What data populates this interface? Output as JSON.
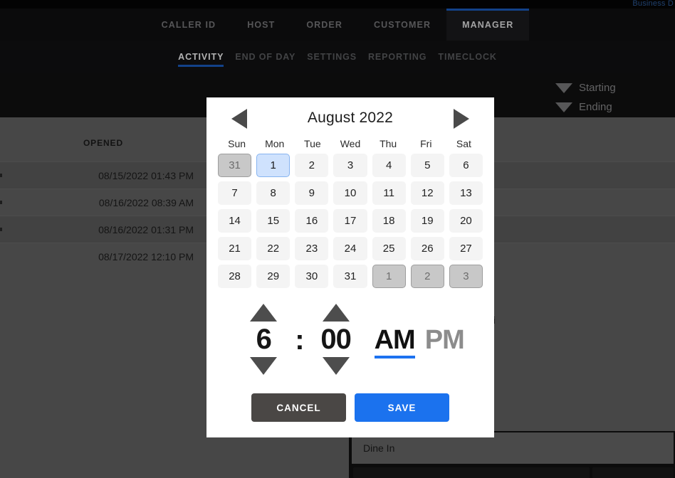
{
  "header": {
    "business_label": "Business D",
    "main_tabs": [
      {
        "label": "CALLER ID",
        "active": false
      },
      {
        "label": "HOST",
        "active": false
      },
      {
        "label": "ORDER",
        "active": false
      },
      {
        "label": "CUSTOMER",
        "active": false
      },
      {
        "label": "MANAGER",
        "active": true
      }
    ],
    "sub_tabs": [
      {
        "label": "ACTIVITY",
        "active": true
      },
      {
        "label": "END OF DAY",
        "active": false
      },
      {
        "label": "SETTINGS",
        "active": false
      },
      {
        "label": "REPORTING",
        "active": false
      },
      {
        "label": "TIMECLOCK",
        "active": false
      }
    ],
    "accent_color": "#1c5fc4"
  },
  "filters": [
    {
      "label": "Starting",
      "icon": "triangle-down-icon"
    },
    {
      "label": "Ending",
      "icon": "triangle-down-icon"
    }
  ],
  "table": {
    "columns": [
      "OPENED"
    ],
    "rows": [
      {
        "opened": "08/15/2022 01:43 PM"
      },
      {
        "opened": "08/16/2022 08:39 AM"
      },
      {
        "opened": "08/16/2022 01:31 PM"
      },
      {
        "opened": "08/17/2022 12:10 PM"
      }
    ]
  },
  "detail": {
    "order_type": "Dine In",
    "ghost_text": "i"
  },
  "modal": {
    "title": "August 2022",
    "prev_icon": "triangle-left-icon",
    "next_icon": "triangle-right-icon",
    "day_names": [
      "Sun",
      "Mon",
      "Tue",
      "Wed",
      "Thu",
      "Fri",
      "Sat"
    ],
    "days": [
      {
        "n": "31",
        "state": "outside"
      },
      {
        "n": "1",
        "state": "selected"
      },
      {
        "n": "2",
        "state": "normal"
      },
      {
        "n": "3",
        "state": "normal"
      },
      {
        "n": "4",
        "state": "normal"
      },
      {
        "n": "5",
        "state": "normal"
      },
      {
        "n": "6",
        "state": "normal"
      },
      {
        "n": "7",
        "state": "normal"
      },
      {
        "n": "8",
        "state": "normal"
      },
      {
        "n": "9",
        "state": "normal"
      },
      {
        "n": "10",
        "state": "normal"
      },
      {
        "n": "11",
        "state": "normal"
      },
      {
        "n": "12",
        "state": "normal"
      },
      {
        "n": "13",
        "state": "normal"
      },
      {
        "n": "14",
        "state": "normal"
      },
      {
        "n": "15",
        "state": "normal"
      },
      {
        "n": "16",
        "state": "normal"
      },
      {
        "n": "17",
        "state": "normal"
      },
      {
        "n": "18",
        "state": "normal"
      },
      {
        "n": "19",
        "state": "normal"
      },
      {
        "n": "20",
        "state": "normal"
      },
      {
        "n": "21",
        "state": "normal"
      },
      {
        "n": "22",
        "state": "normal"
      },
      {
        "n": "23",
        "state": "normal"
      },
      {
        "n": "24",
        "state": "normal"
      },
      {
        "n": "25",
        "state": "normal"
      },
      {
        "n": "26",
        "state": "normal"
      },
      {
        "n": "27",
        "state": "normal"
      },
      {
        "n": "28",
        "state": "normal"
      },
      {
        "n": "29",
        "state": "normal"
      },
      {
        "n": "30",
        "state": "normal"
      },
      {
        "n": "31",
        "state": "normal"
      },
      {
        "n": "1",
        "state": "outside"
      },
      {
        "n": "2",
        "state": "outside"
      },
      {
        "n": "3",
        "state": "outside"
      }
    ],
    "time": {
      "hour": "6",
      "separator": ":",
      "minute": "00",
      "hour_up_icon": "triangle-up-icon",
      "hour_down_icon": "triangle-down-icon",
      "minute_up_icon": "triangle-up-icon",
      "minute_down_icon": "triangle-down-icon",
      "am_label": "AM",
      "pm_label": "PM",
      "meridiem": "AM"
    },
    "buttons": {
      "cancel": "CANCEL",
      "save": "SAVE"
    },
    "save_color": "#1b72ee"
  }
}
